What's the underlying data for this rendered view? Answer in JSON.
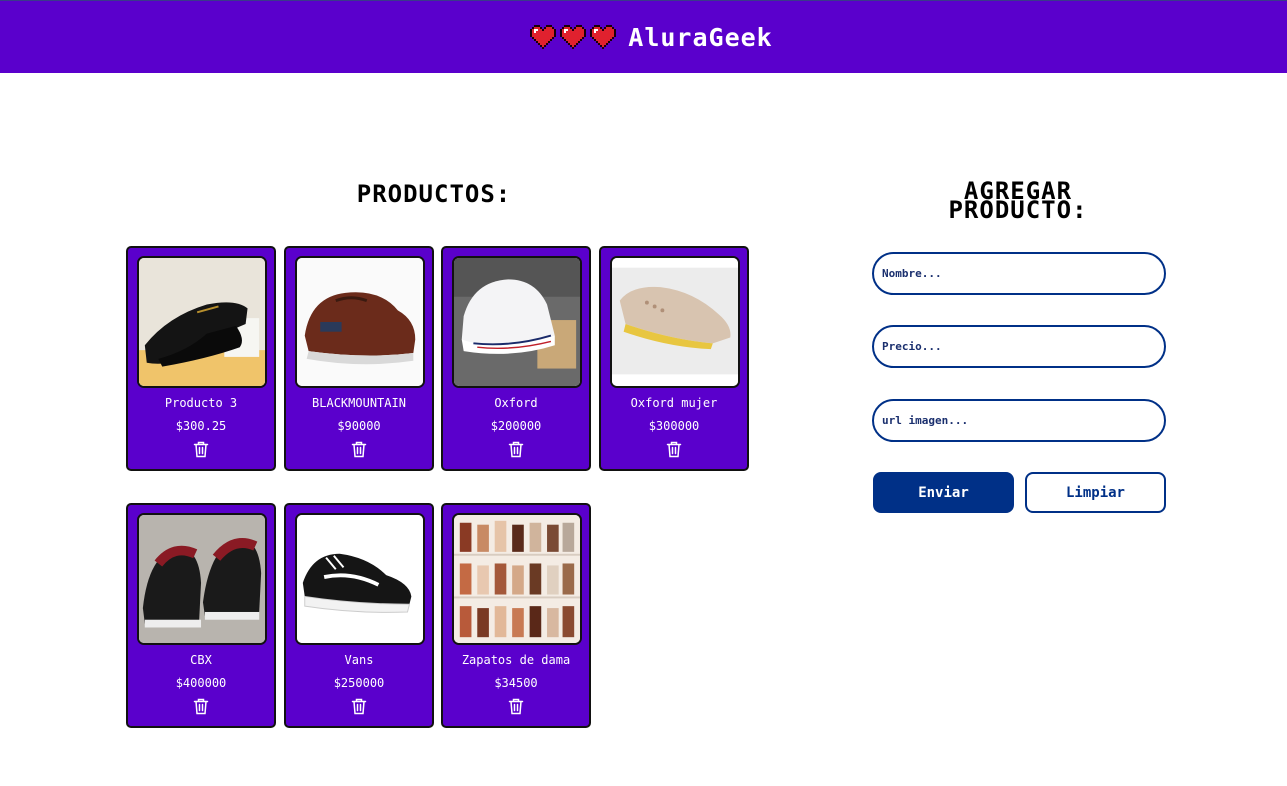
{
  "header": {
    "brand": "AluraGeek",
    "heart_color": "#e0212e",
    "background": "#5a00cc"
  },
  "products": {
    "title": "PRODUCTOS:",
    "items": [
      {
        "name": "Producto 3",
        "price": "$300.25",
        "image": "black-dress-shoe",
        "delete_icon": "trash-icon"
      },
      {
        "name": "BLACKMOUNTAIN",
        "price": "$90000",
        "image": "brown-leather-sneaker",
        "delete_icon": "trash-icon"
      },
      {
        "name": "Oxford",
        "price": "$200000",
        "image": "white-sneaker",
        "delete_icon": "trash-icon"
      },
      {
        "name": "Oxford mujer",
        "price": "$300000",
        "image": "beige-oxford-shoe",
        "delete_icon": "trash-icon"
      },
      {
        "name": "CBX",
        "price": "$400000",
        "image": "red-black-running-shoes",
        "delete_icon": "trash-icon"
      },
      {
        "name": "Vans",
        "price": "$250000",
        "image": "black-white-vans",
        "delete_icon": "trash-icon"
      },
      {
        "name": "Zapatos de dama",
        "price": "$34500",
        "image": "womens-shoes-shelf",
        "delete_icon": "trash-icon"
      }
    ]
  },
  "form": {
    "title_line1": "AGREGAR",
    "title_line2": "PRODUCTO:",
    "name_placeholder": "Nombre...",
    "price_placeholder": "Precio...",
    "image_placeholder": "url imagen...",
    "submit_label": "Enviar",
    "clear_label": "Limpiar",
    "accent_color": "#003087"
  }
}
